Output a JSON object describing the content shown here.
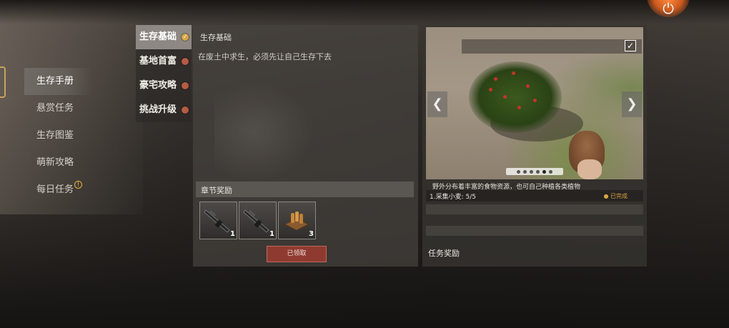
{
  "side_nav": {
    "items": [
      {
        "label": "生存手册",
        "active": true
      },
      {
        "label": "悬赏任务",
        "active": false
      },
      {
        "label": "生存图鉴",
        "active": false
      },
      {
        "label": "萌新攻略",
        "active": false
      },
      {
        "label": "每日任务",
        "active": false,
        "badge": "!"
      }
    ]
  },
  "tabs": [
    {
      "label": "生存基础",
      "active": true
    },
    {
      "label": "基地首富",
      "active": false
    },
    {
      "label": "豪宅攻略",
      "active": false
    },
    {
      "label": "挑战升级",
      "active": false
    }
  ],
  "content": {
    "title": "生存基础",
    "description": "在废土中求生，必须先让自己生存下去",
    "chapter_reward_label": "章节奖励",
    "rewards": [
      {
        "icon": "rifle-icon",
        "qty": "1"
      },
      {
        "icon": "rifle-icon",
        "qty": "1"
      },
      {
        "icon": "ammo-crate-icon",
        "qty": "3"
      }
    ],
    "claimed_label": "已领取"
  },
  "preview": {
    "caption": "野外分布着丰富的食物资源，也可自己种植各类植物",
    "quest": "1.采集小麦: 5/5",
    "quest_status": "已完成",
    "task_reward_label": "任务奖励",
    "pager_total": 6,
    "pager_active": 5
  },
  "colors": {
    "accent_gold": "#d9a53c",
    "claimed_red": "#8f3a31",
    "power_orange": "#ff8a3c"
  }
}
